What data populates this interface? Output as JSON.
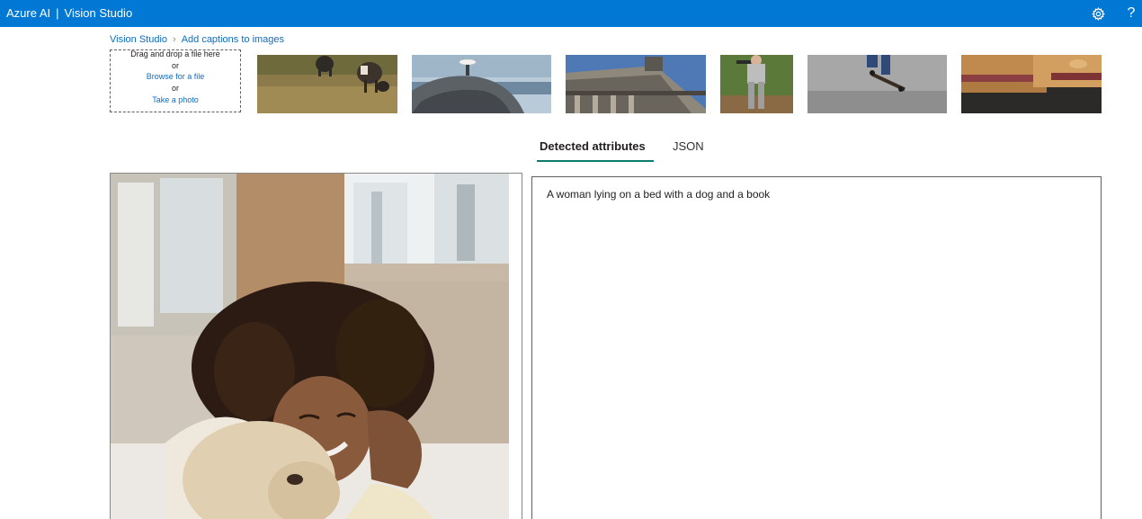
{
  "header": {
    "brand": "Azure AI",
    "separator": "|",
    "product": "Vision Studio",
    "icons": [
      "gear-icon",
      "help-icon"
    ],
    "help_glyph": "?"
  },
  "breadcrumb": {
    "home": "Vision Studio",
    "separator": "›",
    "current": "Add captions to images"
  },
  "upload": {
    "drag_text": "Drag and drop a file here",
    "or_1": "or",
    "browse": "Browse for a file",
    "or_2": "or",
    "take_photo": "Take a photo"
  },
  "samples": [
    {
      "subject": "cows grazing"
    },
    {
      "subject": "person on cliff by sea"
    },
    {
      "subject": "ornate building facade"
    },
    {
      "subject": "baseball player"
    },
    {
      "subject": "skateboarder jumping"
    },
    {
      "subject": "sandwich"
    }
  ],
  "tabs": {
    "detected": "Detected attributes",
    "json": "JSON",
    "active": "Detected attributes"
  },
  "result": {
    "caption": "A woman lying on a bed with a dog and a book"
  },
  "colors": {
    "topbar": "#0078d4",
    "link": "#0f6cbd",
    "tab_underline": "#0f7b6c"
  }
}
